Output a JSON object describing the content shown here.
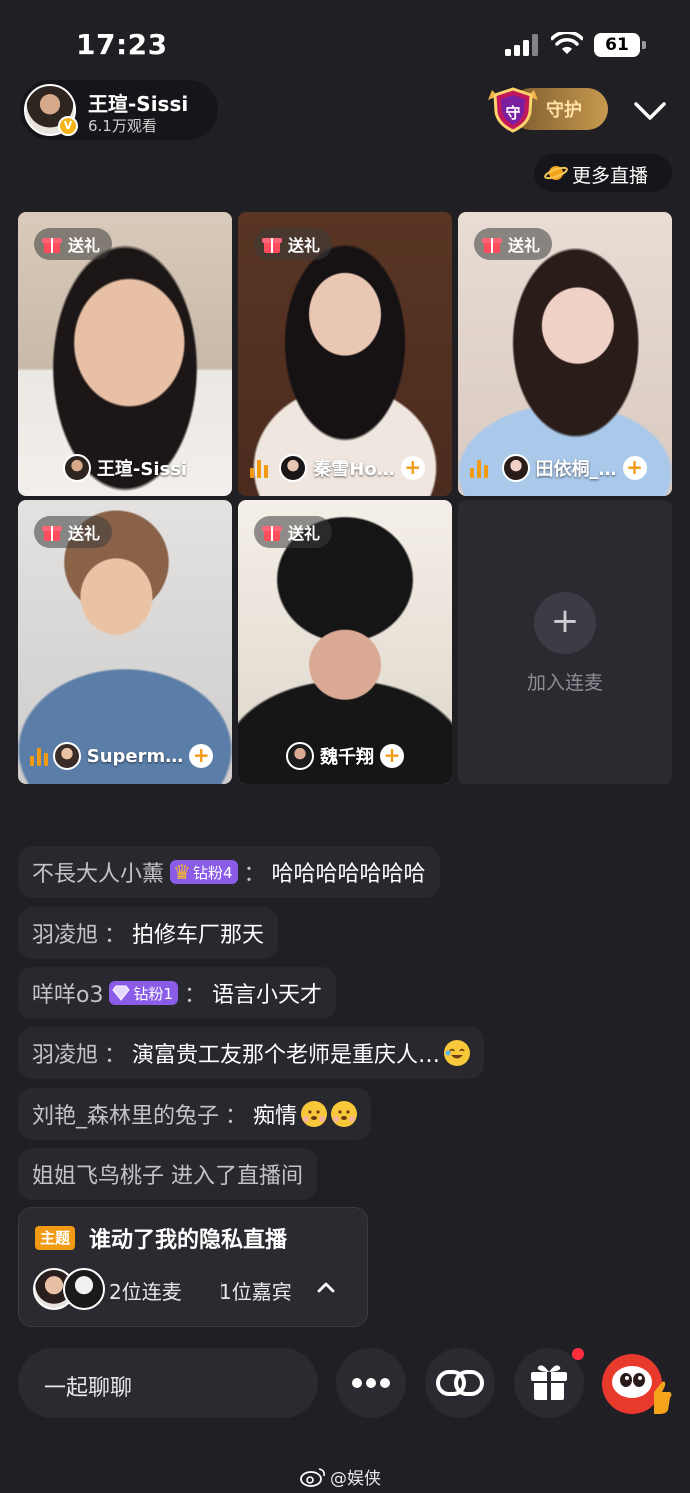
{
  "status_bar": {
    "time": "17:23",
    "battery": "61"
  },
  "host": {
    "name": "王瑄-Sissi",
    "views": "6.1万观看"
  },
  "header": {
    "guard_label": "守护",
    "guard_shield_glyph": "守",
    "more_live_label": "更多直播"
  },
  "tiles": [
    {
      "gift_label": "送礼",
      "name": "王瑄-Sissi"
    },
    {
      "gift_label": "送礼",
      "name": "秦雪Ho…"
    },
    {
      "gift_label": "送礼",
      "name": "田依桐_…"
    },
    {
      "gift_label": "送礼",
      "name": "Superm…"
    },
    {
      "gift_label": "送礼",
      "name": "魏千翔"
    }
  ],
  "add_tile": {
    "plus": "+",
    "label": "加入连麦"
  },
  "chat": [
    {
      "user": "不長大人小薰",
      "badge": "钻粉4",
      "text": "哈哈哈哈哈哈哈"
    },
    {
      "user": "羽凌旭",
      "text": "拍修车厂那天"
    },
    {
      "user": "咩咩o3",
      "badge": "钻粉1",
      "text": "语言小天才"
    },
    {
      "user": "羽凌旭",
      "text": "演富贵工友那个老师是重庆人…"
    },
    {
      "user": "刘艳_森林里的兔子",
      "text": "痴情"
    },
    {
      "text": "姐姐飞鸟桃子 进入了直播间"
    }
  ],
  "separator": "：",
  "topic": {
    "tag": "主题",
    "title": "谁动了我的隐私直播",
    "mic_count": "2位连麦",
    "guest_count": "1位嘉宾"
  },
  "bottom_bar": {
    "chat_placeholder": "一起聊聊"
  },
  "watermark": "@娱侠",
  "icons": [
    "signal-icon",
    "wifi-icon",
    "battery-icon",
    "verified-icon",
    "guard-shield-icon",
    "chevron-down-icon",
    "planet-icon",
    "gift-icon",
    "audio-bars-icon",
    "plus-icon",
    "crown-icon",
    "gem-icon",
    "laugh-emoji",
    "shy-emoji",
    "chevron-up-icon",
    "more-icon",
    "link-icon",
    "gift-box-icon",
    "mascot-icon",
    "weibo-icon"
  ],
  "colors": {
    "background": "#1f1f24",
    "accent_orange": "#f29a12",
    "badge_purple": "#8a5ce8",
    "notify_red": "#ff2d3f"
  }
}
